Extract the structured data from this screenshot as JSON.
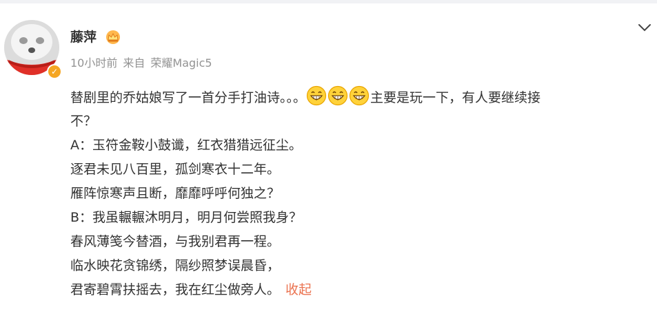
{
  "post": {
    "username": "藤萍",
    "time": "10小时前",
    "source_prefix": "来自",
    "source_device": "荣耀Magic5",
    "intro_before_emoji": "替剧里的乔姑娘写了一首分手打油诗。。。",
    "intro_after_emoji": "主要是玩一下，有人要继续接",
    "intro_wrap": "不？",
    "lines": [
      "A：玉符金鞍小鼓谶，红衣猎猎远征尘。",
      "逐君未见八百里，孤剑寒衣十二年。",
      "雁阵惊寒声且断，靡靡呼呼何独之？",
      "B：我虽輾輾沐明月，明月何尝照我身？",
      "春风薄笺今替酒，与我别君再一程。",
      "临水映花贪锦绣，隔纱照梦误晨昏，"
    ],
    "last_line": "君寄碧霄扶摇去，我在红尘做旁人。",
    "collapse_label": "收起"
  },
  "icons": {
    "verified": "verified-badge-icon",
    "crown": "crown-icon",
    "chevron": "chevron-down-icon",
    "emoji": "grin-emoji-icon"
  },
  "colors": {
    "text": "#333333",
    "meta": "#939393",
    "link": "#eb7350",
    "badge": "#f5a623"
  }
}
